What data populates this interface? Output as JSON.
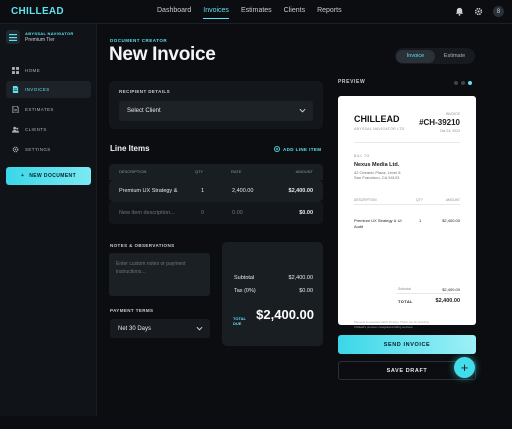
{
  "app": {
    "logo": "CHILLEAD"
  },
  "topnav": {
    "items": [
      "Dashboard",
      "Invoices",
      "Estimates",
      "Clients",
      "Reports"
    ],
    "active": "Invoices",
    "avatar": "8"
  },
  "sidebar": {
    "workspace_sub": "ABYSSAL NAVIGATOR",
    "workspace_tier": "Premium Tier",
    "items": [
      {
        "label": "HOME",
        "icon": "grid-icon"
      },
      {
        "label": "INVOICES",
        "icon": "document-icon"
      },
      {
        "label": "ESTIMATES",
        "icon": "file-icon"
      },
      {
        "label": "CLIENTS",
        "icon": "users-icon"
      },
      {
        "label": "SETTINGS",
        "icon": "gear-icon"
      }
    ],
    "active": "INVOICES",
    "new_doc": "NEW DOCUMENT"
  },
  "header": {
    "crumb": "DOCUMENT CREATOR",
    "title": "New Invoice",
    "toggle": [
      "Invoice",
      "Estimate"
    ],
    "toggle_active": "Invoice"
  },
  "recipient": {
    "label": "RECIPIENT DETAILS",
    "select": "Select Client"
  },
  "line_items": {
    "title": "Line Items",
    "add": "ADD LINE ITEM",
    "columns": [
      "DESCRIPTION",
      "QTY",
      "RATE",
      "AMOUNT"
    ],
    "rows": [
      {
        "desc": "Premium UX Strategy &",
        "qty": "1",
        "rate": "2,400.00",
        "amount": "$2,400.00"
      }
    ],
    "new_row": {
      "desc": "New item description...",
      "qty": "0",
      "rate": "0.00",
      "amount": "$0.00"
    }
  },
  "notes": {
    "label": "NOTES & OBSERVATIONS",
    "placeholder": "Enter custom notes or payment instructions..."
  },
  "payment": {
    "label": "PAYMENT TERMS",
    "value": "Net 30 Days"
  },
  "totals": {
    "subtotal_label": "Subtotal",
    "subtotal": "$2,400.00",
    "tax_label": "Tax (0%)",
    "tax": "$0.00",
    "total_label1": "TOTAL",
    "total_label2": "DUE",
    "total": "$2,400.00"
  },
  "preview": {
    "label": "PREVIEW",
    "logo": "CHILLEAD",
    "sub": "ABYSSAL NAVIGATOR LTD.",
    "inv_label": "INVOICE",
    "inv_no": "#CH-39210",
    "date": "Oct 24, 2023",
    "bill_label": "BILL TO",
    "client": "Nexus Media Ltd.",
    "addr1": "42 Oceanic Plaza, Level 8",
    "addr2": "San Francisco, CA 94103",
    "cols": [
      "DESCRIPTION",
      "QTY",
      "AMOUNT"
    ],
    "row_desc1": "Premium UX Strategy & UI",
    "row_desc2": "Audit",
    "row_qty": "1",
    "row_amount": "$2,400.00",
    "subtotal_label": "Subtotal",
    "subtotal": "$2,400.00",
    "total_label": "TOTAL",
    "total": "$2,400.00",
    "foot1": "Payment is expected within 30 days. Thank you for choosing",
    "foot2": "Chillead's premium navigational billing services."
  },
  "actions": {
    "send": "SEND INVOICE",
    "draft": "SAVE DRAFT",
    "fab": "+"
  },
  "colors": {
    "accent": "#5fe1f0",
    "bg": "#0b0d10"
  }
}
